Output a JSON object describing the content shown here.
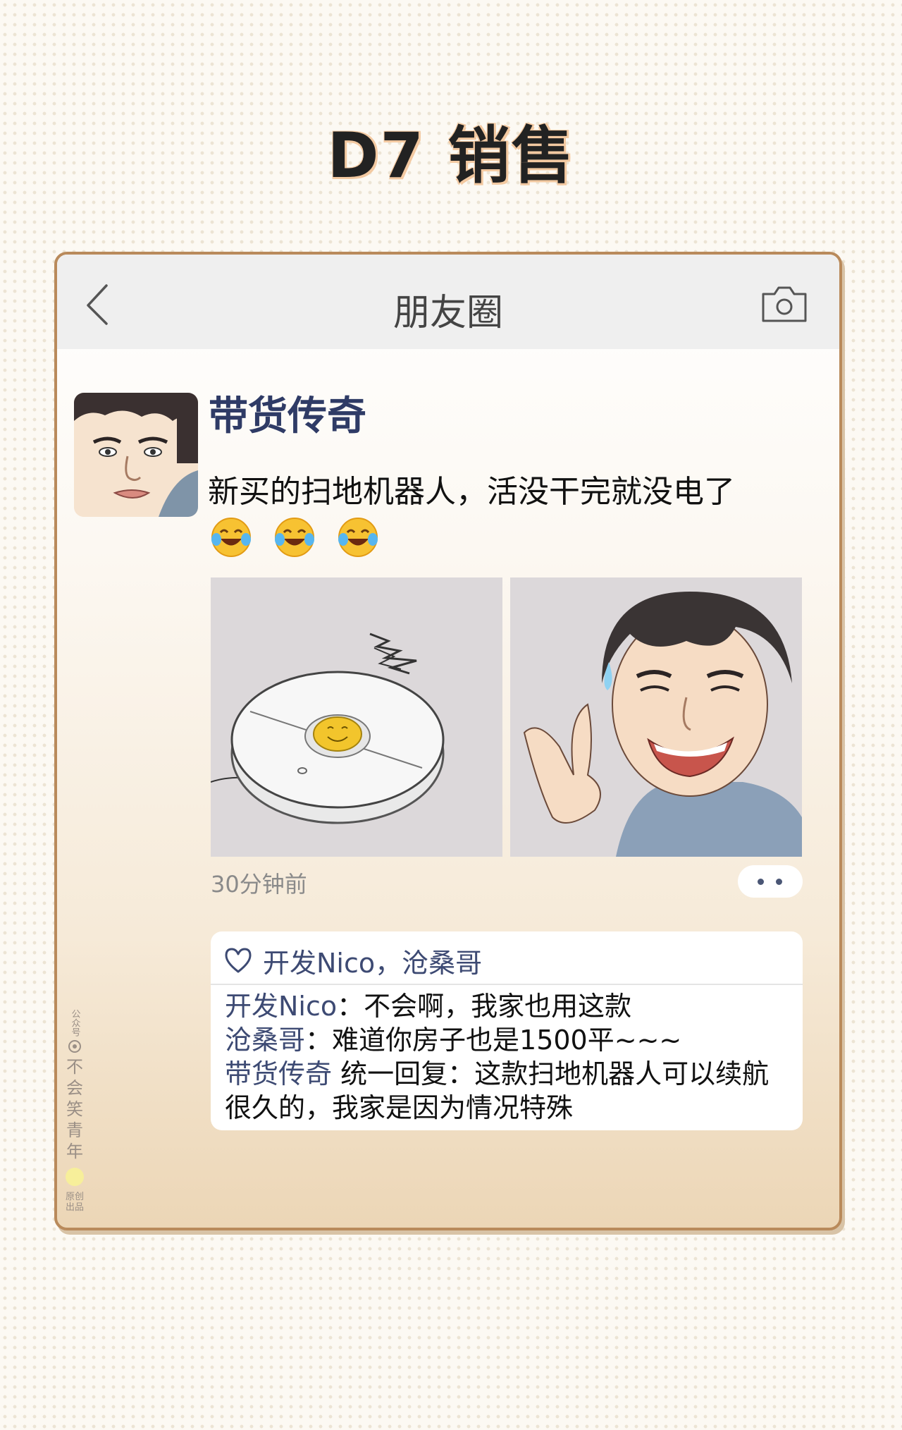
{
  "page": {
    "title": "D7 销售"
  },
  "nav": {
    "title": "朋友圈",
    "back_icon": "chevron-left-icon",
    "camera_icon": "camera-icon"
  },
  "post": {
    "author": "带货传奇",
    "text": "新买的扫地机器人，活没干完就没电了",
    "emojis": [
      "tears-of-joy-emoji",
      "tears-of-joy-emoji",
      "tears-of-joy-emoji"
    ],
    "photos": [
      "robot-vacuum-illustration",
      "smiling-man-peace-sign-illustration"
    ],
    "time": "30分钟前"
  },
  "likes": {
    "icon": "heart-outline-icon",
    "names": "开发Nico，沧桑哥"
  },
  "comments": [
    {
      "author": "开发Nico",
      "sep": "：",
      "text": "不会啊，我家也用这款"
    },
    {
      "author": "沧桑哥",
      "sep": "：",
      "text": "难道你房子也是1500平~~~"
    },
    {
      "author": "带货传奇",
      "sep": " ",
      "text": "统一回复：这款扫地机器人可以续航"
    },
    {
      "author": "",
      "sep": "",
      "text": "很久的，我家是因为情况特殊"
    }
  ],
  "watermark": {
    "top": "公众号",
    "name_chars": [
      "不",
      "会",
      "笑",
      "青",
      "年"
    ],
    "bottom": "原创出品"
  },
  "colors": {
    "accent_name": "#3d4a73",
    "card_border": "#b98a5b",
    "title_shadow": "#f3c9a1"
  }
}
